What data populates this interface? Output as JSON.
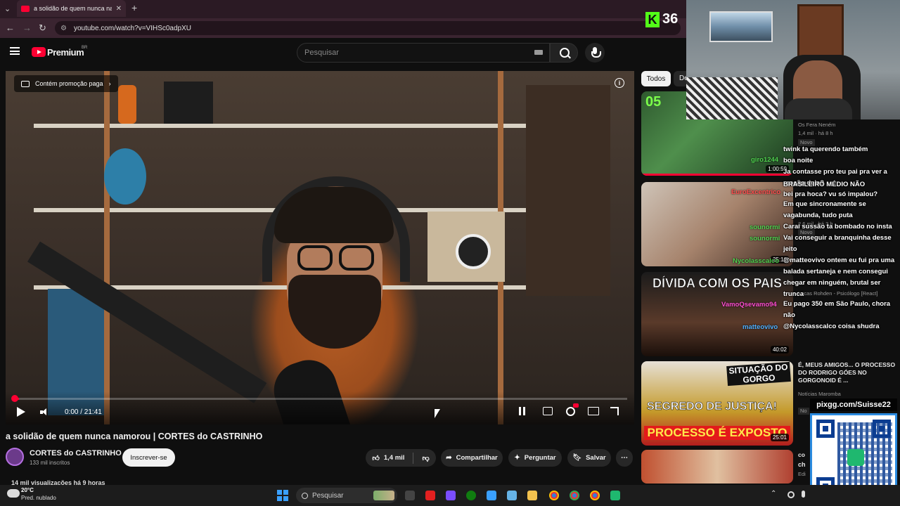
{
  "browser": {
    "tab_title": "a solidão de quem nunca namorou | CORTES do CASTRINHO - YouTube",
    "url": "youtube.com/watch?v=VIHSc0adpXU"
  },
  "youtube": {
    "brand": "Premium",
    "region": "BR",
    "search_placeholder": "Pesquisar"
  },
  "player": {
    "promo_chip": "Contém promoção paga",
    "current_time": "0:00",
    "duration": "21:41",
    "time_display": "0:00 / 21:41",
    "progress_fraction": 0.0
  },
  "video": {
    "title": "a solidão de quem nunca namorou | CORTES do CASTRINHO",
    "channel": "CORTES do CASTRINHO",
    "subscribers": "133 mil inscritos",
    "subscribe_label": "Inscrever-se",
    "likes": "1,4 mil",
    "share_label": "Compartilhar",
    "ask_label": "Perguntar",
    "save_label": "Salvar",
    "views_line": "14 mil visualizações há 9 horas"
  },
  "sidebar": {
    "filters": [
      "Todos",
      "De"
    ],
    "recommendations": [
      {
        "title": "",
        "meta_channel": "Os Fera Neném",
        "meta_stats": "1,4 mil · há 8 h",
        "badge": "Novo",
        "duration": "1:00:59",
        "thumb_text": "05"
      },
      {
        "title": "",
        "meta_channel": "",
        "meta_stats": "2,6 mil · há 3 h",
        "badge": "Novo",
        "duration": "25:10"
      },
      {
        "title": "",
        "meta_channel": "Lucas Rohden - Psicólogo [React]",
        "meta_stats": "",
        "badge": "",
        "duration": "40:02",
        "thumb_text": "DÍVIDA COM OS PAIS"
      },
      {
        "title": "É, MEUS AMIGOS... O PROCESSO DO RODRIGO GÓES NO GORGONOID É ...",
        "meta_channel": "Notícias Maromba",
        "meta_stats": "",
        "badge": "No",
        "duration": "25:01",
        "thumb_text_top": "SITUAÇÃO DO GORGO",
        "thumb_text_mid": "SEGREDO DE JUSTIÇA!",
        "thumb_text_bottom": "PROCESSO É EXPOSTO"
      },
      {
        "title": "co",
        "meta_channel": "ch",
        "meta_stats": "Edi",
        "badge": "",
        "duration": ""
      }
    ]
  },
  "stream": {
    "kick_logo": "K",
    "viewer_count": "36",
    "qr_label": "pixgg.com/Suisse22",
    "overlay_names": [
      {
        "text": "giro1244",
        "color": "#4fd14f"
      },
      {
        "text": "EuroExcentrico",
        "color": "#ff4d4d"
      },
      {
        "text": "sounormi",
        "color": "#4fd14f"
      },
      {
        "text": "sounormi",
        "color": "#4fd14f"
      },
      {
        "text": "Nycolasscalco",
        "color": "#4fd14f"
      },
      {
        "text": "VamoQsevamo94",
        "color": "#ff4dd2"
      },
      {
        "text": "matteovivo",
        "color": "#4fb0ff"
      }
    ],
    "chat": [
      "twink ta querendo também",
      "boa noite",
      "Ja contasse pro teu pai pra ver a reação dele?",
      "BRASILEIRO MÉDIO NÃO",
      "bei pra hoca? vu só impalou?",
      "Em que sincronamente se",
      "vagabunda, tudo puta",
      "Carai sussão ta bombado no insta",
      "Vai conseguir a branquinha desse jeito",
      "@matteovivo ontem eu fui pra uma balada sertaneja e nem consegui chegar em ninguém, brutal ser trunca",
      "Eu pago 350 em São Paulo, chora não",
      "@Nycolasscalco coisa shudra"
    ]
  },
  "taskbar": {
    "temperature": "20°C",
    "weather": "Pred. nublado",
    "search_placeholder": "Pesquisar"
  },
  "colors": {
    "youtube_red": "#ff0033",
    "kick_green": "#53fc18",
    "background": "#0f0f0f"
  }
}
